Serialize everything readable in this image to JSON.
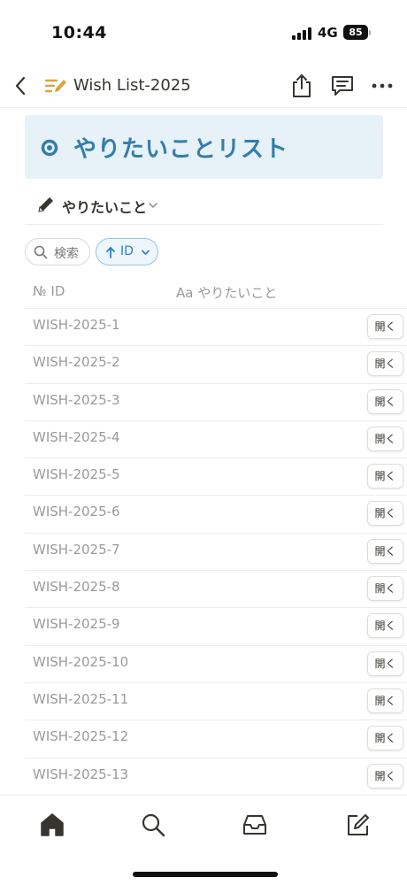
{
  "status_bar": {
    "time": "10:44",
    "network": "4G",
    "battery": "85"
  },
  "nav": {
    "title": "Wish List-2025",
    "icons": [
      "back-chevron-icon",
      "page-pencil-icon",
      "share-icon",
      "comment-icon",
      "more-icon"
    ]
  },
  "callout": {
    "heading": "やりたいことリスト",
    "icon": "circle-dot-icon",
    "color": "#337ea9",
    "background": "#e7f1f8"
  },
  "view": {
    "label": "やりたいこと",
    "icon": "pencil-icon"
  },
  "filters": {
    "search_label": "検索",
    "sort_label": "ID"
  },
  "table": {
    "columns": [
      {
        "prefix": "№",
        "label": "ID"
      },
      {
        "prefix": "Aa",
        "label": "やりたいこと"
      }
    ],
    "open_label": "開く",
    "rows": [
      "WISH-2025-1",
      "WISH-2025-2",
      "WISH-2025-3",
      "WISH-2025-4",
      "WISH-2025-5",
      "WISH-2025-6",
      "WISH-2025-7",
      "WISH-2025-8",
      "WISH-2025-9",
      "WISH-2025-10",
      "WISH-2025-11",
      "WISH-2025-12",
      "WISH-2025-13"
    ]
  },
  "tabbar": {
    "items": [
      "home-icon",
      "search-icon",
      "inbox-icon",
      "compose-icon"
    ]
  },
  "colors": {
    "accent": "#2383c4",
    "muted_text": "#9b9a97",
    "page_icon": "#d9a441"
  }
}
